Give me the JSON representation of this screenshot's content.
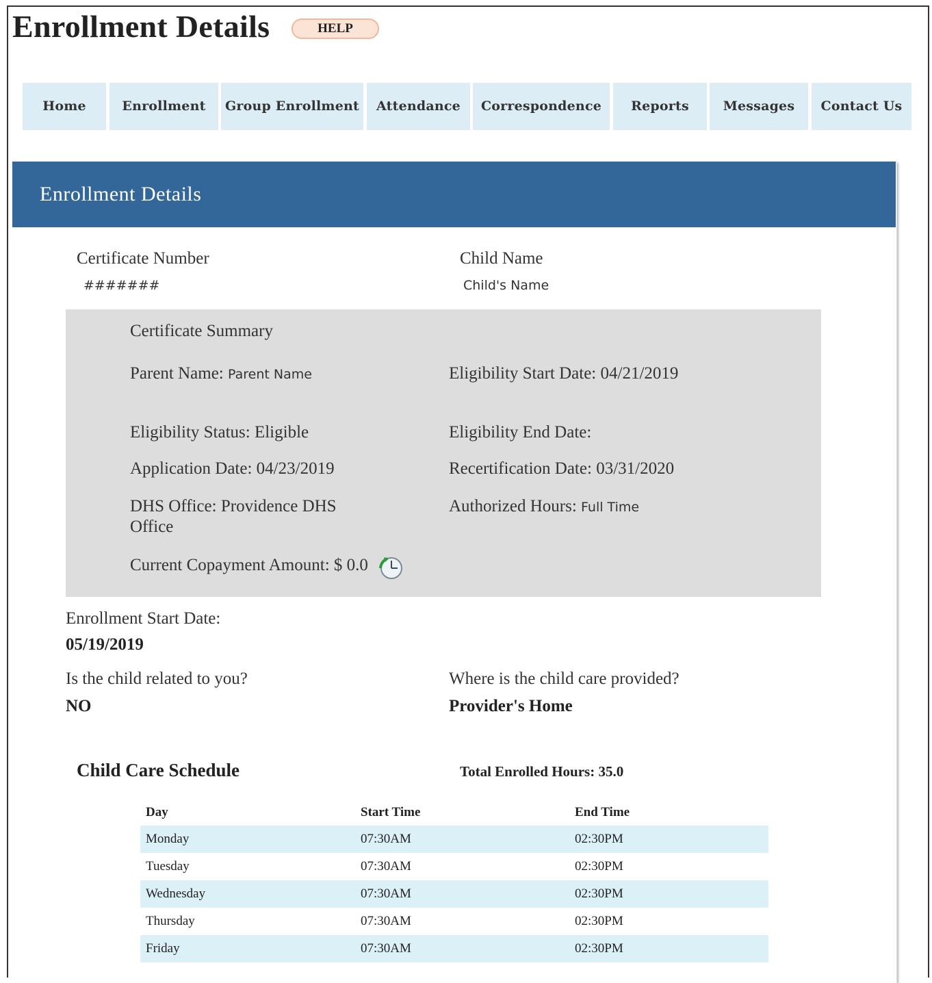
{
  "page": {
    "title": "Enrollment Details",
    "help_label": "HELP"
  },
  "nav": {
    "items": [
      "Home",
      "Enrollment",
      "Group Enrollment",
      "Attendance",
      "Correspondence",
      "Reports",
      "Messages",
      "Contact Us"
    ]
  },
  "panel": {
    "header": "Enrollment Details",
    "certificate_number_label": "Certificate Number",
    "certificate_number_value": "#######",
    "child_name_label": "Child Name",
    "child_name_value": "Child's Name"
  },
  "summary": {
    "title": "Certificate Summary",
    "parent_name_label": "Parent Name:",
    "parent_name_value": "Parent Name",
    "elig_start_label": "Eligibility Start Date:",
    "elig_start_value": "04/21/2019",
    "elig_status_label": "Eligibility Status:",
    "elig_status_value": "Eligible",
    "elig_end_label": "Eligibility End Date:",
    "elig_end_value": "",
    "app_date_label": "Application Date:",
    "app_date_value": "04/23/2019",
    "recert_label": "Recertification Date:",
    "recert_value": "03/31/2020",
    "dhs_office_label": "DHS Office:",
    "dhs_office_value_line1": "Providence DHS",
    "dhs_office_value_line2": "Office",
    "auth_hours_label": "Authorized Hours:",
    "auth_hours_value": "Full Time",
    "copay_label": "Current Copayment Amount:",
    "copay_value": "$ 0.0",
    "copay_icon": "history-clock-icon"
  },
  "enrollment": {
    "start_date_label": "Enrollment Start Date:",
    "start_date_value": "05/19/2019",
    "related_label": "Is the child related to you?",
    "related_value": "NO",
    "location_label": "Where is the child care provided?",
    "location_value": "Provider's Home"
  },
  "schedule": {
    "title": "Child Care Schedule",
    "total_hours": "Total Enrolled Hours: 35.0",
    "columns": [
      "Day",
      "Start Time",
      "End Time"
    ],
    "rows": [
      [
        "Monday",
        "07:30AM",
        "02:30PM"
      ],
      [
        "Tuesday",
        "07:30AM",
        "02:30PM"
      ],
      [
        "Wednesday",
        "07:30AM",
        "02:30PM"
      ],
      [
        "Thursday",
        "07:30AM",
        "02:30PM"
      ],
      [
        "Friday",
        "07:30AM",
        "02:30PM"
      ]
    ]
  },
  "colors": {
    "header_blue": "#336699",
    "nav_bg": "#dcedf5",
    "summary_bg": "#dddddd",
    "row_alt": "#dcf0f8",
    "help_bg": "#fbe3d6"
  }
}
